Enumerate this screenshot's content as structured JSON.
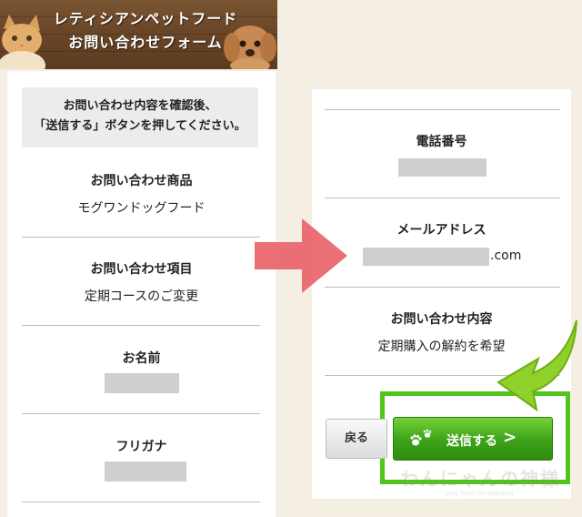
{
  "header": {
    "title_line1": "レティシアンペットフード",
    "title_line2": "お問い合わせフォーム"
  },
  "left_panel": {
    "notice_line1": "お問い合わせ内容を確認後、",
    "notice_line2": "「送信する」ボタンを押してください。",
    "fields": [
      {
        "label": "お問い合わせ商品",
        "value": "モグワンドッグフード"
      },
      {
        "label": "お問い合わせ項目",
        "value": "定期コースのご変更"
      },
      {
        "label": "お名前",
        "value": ""
      },
      {
        "label": "フリガナ",
        "value": ""
      }
    ]
  },
  "right_panel": {
    "fields": [
      {
        "label": "電話番号",
        "value": ""
      },
      {
        "label": "メールアドレス",
        "value": ".com"
      },
      {
        "label": "お問い合わせ内容",
        "value": "定期購入の解約を希望"
      }
    ]
  },
  "buttons": {
    "back_label": "戻る",
    "send_label": "送信する",
    "send_chevron": ">"
  },
  "watermark": {
    "text": "わんにゃんの神様",
    "sub": "Dog food for Kawaisa"
  },
  "colors": {
    "highlight": "#52c41a",
    "arrow_red": "#e8646a",
    "arrow_green": "#8fd12a"
  }
}
